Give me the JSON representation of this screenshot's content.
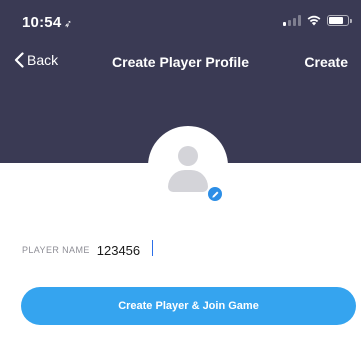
{
  "status_bar": {
    "time": "10:54",
    "location_icon": "location-arrow-icon",
    "signal_icon": "signal-icon",
    "wifi_icon": "wifi-icon",
    "battery_icon": "battery-icon"
  },
  "nav": {
    "back_label": "Back",
    "title": "Create Player Profile",
    "create_label": "Create"
  },
  "avatar": {
    "placeholder_icon": "person-icon",
    "edit_icon": "pencil-icon"
  },
  "form": {
    "player_name_label": "PLAYER NAME",
    "player_name_value": "123456"
  },
  "actions": {
    "join_label": "Create Player & Join Game"
  },
  "colors": {
    "header_bg": "#3a3a54",
    "accent_blue": "#35a4ef",
    "edit_badge": "#2c8ee6"
  }
}
